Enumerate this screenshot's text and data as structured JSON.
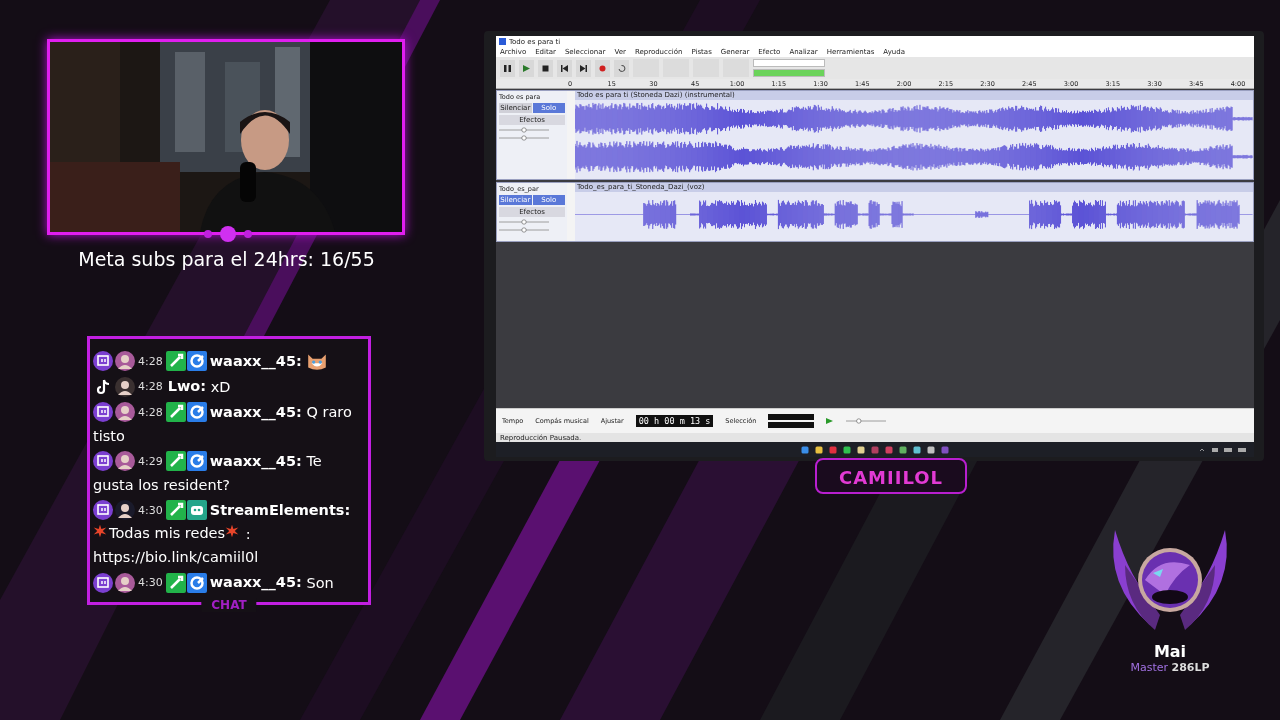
{
  "stream": {
    "subs_goal": "Meta subs para el 24hrs: 16/55",
    "chat_label": "CHAT",
    "channel_plate": "CAMIILOL"
  },
  "chat": {
    "messages": [
      {
        "kind": "twitch",
        "time": "4:28",
        "user": "waaxx__45:",
        "parts": [
          {
            "kind": "emote"
          }
        ]
      },
      {
        "kind": "tiktok",
        "time": "4:28",
        "user": "Lwo:",
        "parts": [
          {
            "kind": "text",
            "text": "xD"
          }
        ]
      },
      {
        "kind": "twitch",
        "time": "4:28",
        "user": "waaxx__45:",
        "parts": [
          {
            "kind": "text",
            "text": "Q raro"
          },
          {
            "kind": "text",
            "text": "tisto"
          }
        ]
      },
      {
        "kind": "twitch",
        "time": "4:29",
        "user": "waaxx__45:",
        "parts": [
          {
            "kind": "text",
            "text": "Te"
          },
          {
            "kind": "text",
            "text": "gusta los resident?"
          }
        ]
      },
      {
        "kind": "bot",
        "time": "4:30",
        "user": "StreamElements:",
        "parts": [
          {
            "kind": "burst"
          },
          {
            "kind": "text",
            "text": "Todas mis redes"
          },
          {
            "kind": "burst"
          },
          {
            "kind": "text",
            "text": ":"
          },
          {
            "kind": "link",
            "text": "https://bio.link/camiil0l"
          }
        ]
      },
      {
        "kind": "twitch",
        "time": "4:30",
        "user": "waaxx__45:",
        "parts": [
          {
            "kind": "text",
            "text": "Son"
          }
        ]
      }
    ]
  },
  "app_window": {
    "title": "Todo es para ti",
    "menu": [
      "Archivo",
      "Editar",
      "Seleccionar",
      "Ver",
      "Reproducción",
      "Pistas",
      "Generar",
      "Efecto",
      "Analizar",
      "Herramientas",
      "Ayuda"
    ],
    "ruler": [
      "0",
      "15",
      "30",
      "45",
      "1:00",
      "1:15",
      "1:30",
      "1:45",
      "2:00",
      "2:15",
      "2:30",
      "2:45",
      "3:00",
      "3:15",
      "3:30",
      "3:45",
      "4:00"
    ],
    "tracks": [
      {
        "kind": "stereo",
        "name": "Todo es para",
        "clip": "Todo es para ti (Stoneda Dazi) (instrumental)",
        "effects": "Efectos",
        "buttons": [
          {
            "label": "Silenciar",
            "selected": false
          },
          {
            "label": "Solo",
            "selected": true
          }
        ],
        "gain": {
          "level": 0.5
        },
        "pan": {
          "level": 0.5
        }
      },
      {
        "kind": "mono",
        "name": "Todo_es_par",
        "clip": "Todo_es_para_ti_Stoneda_Dazi_(voz)",
        "effects": "Efectos",
        "buttons": [
          {
            "label": "Silenciar",
            "selected": true
          },
          {
            "label": "Solo",
            "selected": true
          }
        ],
        "gain": {
          "level": 0.5
        },
        "pan": {
          "level": 0.5
        }
      }
    ],
    "bottom_labels": [
      "Tempo",
      "Compás musical",
      "Ajustar"
    ],
    "time": "00 h 00 m 13 s",
    "selection_label": "Selección",
    "speed": {
      "level": 0.3
    },
    "status": "Reproducción Pausada."
  },
  "rank": {
    "name": "Mai",
    "tier": "Master",
    "lp": "286LP"
  }
}
